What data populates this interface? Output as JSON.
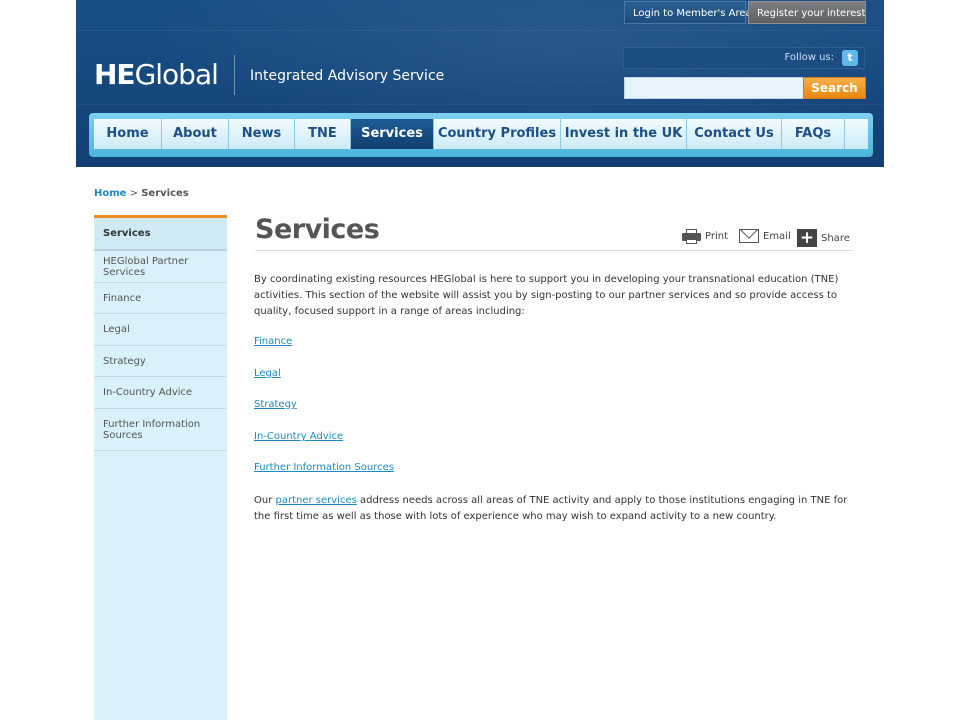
{
  "top_bar": {
    "login_label": "Login to Member's Area",
    "register_label": "Register your interest"
  },
  "brand": {
    "logo_bold": "HE",
    "logo_light": "Global",
    "tagline": "Integrated Advisory Service"
  },
  "social": {
    "follow_label": "Follow us:",
    "twitter_icon": "twitter-icon",
    "twitter_glyph": "t"
  },
  "search": {
    "value": "",
    "placeholder": "",
    "button_label": "Search"
  },
  "nav": {
    "items": [
      {
        "label": "Home"
      },
      {
        "label": "About"
      },
      {
        "label": "News"
      },
      {
        "label": "TNE"
      },
      {
        "label": "Services",
        "active": true
      },
      {
        "label": "Country Profiles"
      },
      {
        "label": "Invest in the UK"
      },
      {
        "label": "Contact Us"
      },
      {
        "label": "FAQs"
      }
    ]
  },
  "breadcrumb": {
    "home": "Home",
    "separator": ">",
    "current": "Services"
  },
  "sidebar": {
    "items": [
      {
        "label": "Services",
        "active": true
      },
      {
        "label": "HEGlobal Partner Services"
      },
      {
        "label": "Finance"
      },
      {
        "label": "Legal"
      },
      {
        "label": "Strategy"
      },
      {
        "label": "In-Country Advice"
      },
      {
        "label": "Further Information Sources"
      }
    ]
  },
  "content": {
    "title": "Services",
    "tools": {
      "print": "Print",
      "email": "Email",
      "share": "Share",
      "share_glyph": "+"
    },
    "intro": "By coordinating existing resources HEGlobal is here to support you in developing your transnational education (TNE) activities. This section of the website will assist you by sign-posting to our partner services and so provide access to quality, focused support in a range of areas including:",
    "links": [
      "Finance",
      "Legal",
      "Strategy",
      "In-Country Advice",
      "Further Information Sources"
    ],
    "closing_before": "Our ",
    "closing_link": "partner services",
    "closing_after": " address needs across all areas of TNE activity and apply to those institutions engaging in TNE for the first time as well as those with lots of experience who may wish to expand activity to a new country."
  },
  "colors": {
    "header_blue": "#16497f",
    "nav_active": "#1d5c96",
    "accent_orange": "#e8860f",
    "link_blue": "#1a8bc2",
    "sidebar_bg": "#d9f1fa"
  }
}
